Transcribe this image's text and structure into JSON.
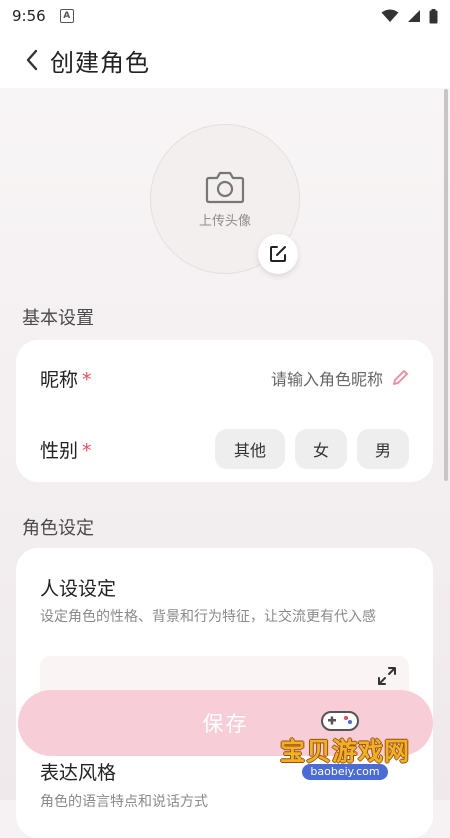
{
  "status_bar": {
    "time": "9:56",
    "notification_badge": "A"
  },
  "header": {
    "title": "创建角色"
  },
  "avatar": {
    "upload_label": "上传头像"
  },
  "basic_settings": {
    "section_title": "基本设置",
    "nickname_label": "昵称",
    "required_mark": "*",
    "nickname_placeholder": "请输入角色昵称",
    "gender_label": "性别",
    "gender_options": [
      "其他",
      "女",
      "男"
    ]
  },
  "role_settings": {
    "section_title": "角色设定",
    "persona_title": "人设设定",
    "persona_desc": "设定角色的性格、背景和行为特征，让交流更有代入感",
    "style_title": "表达风格",
    "style_desc": "角色的语言特点和说话方式"
  },
  "save_button": {
    "label": "保存"
  },
  "watermark": {
    "text": "宝贝游戏网",
    "url": "baobeiy.com"
  },
  "colors": {
    "accent": "#f7cdd8",
    "required": "#f04b5c"
  }
}
